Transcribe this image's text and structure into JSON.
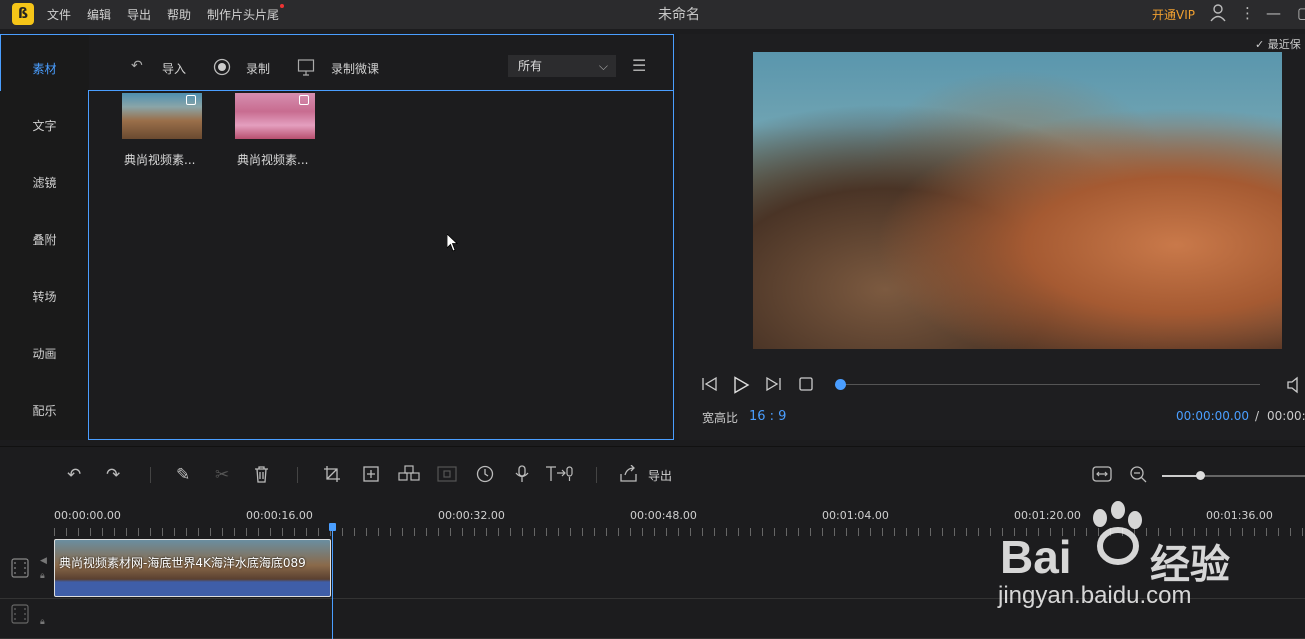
{
  "titlebar": {
    "menu": [
      "文件",
      "编辑",
      "导出",
      "帮助",
      "制作片头片尾"
    ],
    "title": "未命名",
    "vip": "开通VIP"
  },
  "leftnav": {
    "items": [
      "素材",
      "文字",
      "滤镜",
      "叠附",
      "转场",
      "动画",
      "配乐"
    ],
    "active": "素材"
  },
  "library": {
    "import_label": "导入",
    "record_label": "录制",
    "record_lesson_label": "录制微课",
    "filter_value": "所有",
    "items": [
      {
        "label": "典尚视频素..."
      },
      {
        "label": "典尚视频素..."
      }
    ]
  },
  "preview": {
    "last_save": "最近保",
    "aspect_label": "宽高比",
    "aspect_value": "16 : 9",
    "current_time": "00:00:00.00",
    "separator": "/",
    "total_time": "00:00:"
  },
  "timeline": {
    "export_label": "导出",
    "ruler": [
      "00:00:00.00",
      "00:00:16.00",
      "00:00:32.00",
      "00:00:48.00",
      "00:01:04.00",
      "00:01:20.00",
      "00:01:36.00"
    ],
    "clip_label": "典尚视频素材网-海底世界4K海洋水底海底089",
    "zoom_level": 0.27
  },
  "watermark": {
    "brand": "Bai",
    "brand_cn": "经验",
    "url": "jingyan.baidu.com"
  },
  "colors": {
    "accent": "#4a9eff",
    "vip": "#f0a030",
    "bg": "#1c1c1e"
  }
}
